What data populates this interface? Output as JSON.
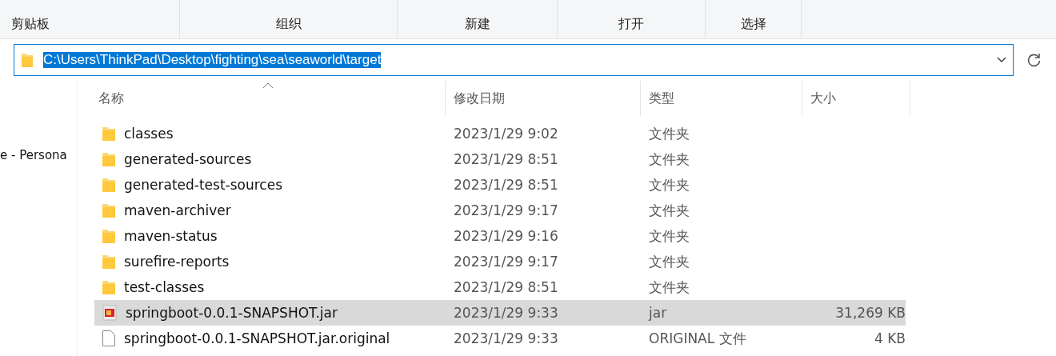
{
  "ribbon": {
    "groups": [
      "剪贴板",
      "组织",
      "新建",
      "打开",
      "选择"
    ]
  },
  "address_bar": {
    "path": "C:\\Users\\ThinkPad\\Desktop\\fighting\\sea\\seaworld\\target",
    "selected": true
  },
  "navigation": {
    "items": [
      "e - Persona"
    ]
  },
  "columns": [
    {
      "label": "名称",
      "sorted": true
    },
    {
      "label": "修改日期",
      "sorted": false
    },
    {
      "label": "类型",
      "sorted": false
    },
    {
      "label": "大小",
      "sorted": false
    }
  ],
  "rows": [
    {
      "kind": "folder",
      "name": "classes",
      "date": "2023/1/29 9:02",
      "type": "文件夹",
      "selected": false
    },
    {
      "kind": "folder",
      "name": "generated-sources",
      "date": "2023/1/29 8:51",
      "type": "文件夹",
      "selected": false
    },
    {
      "kind": "folder",
      "name": "generated-test-sources",
      "date": "2023/1/29 8:51",
      "type": "文件夹",
      "selected": false
    },
    {
      "kind": "folder",
      "name": "maven-archiver",
      "date": "2023/1/29 9:17",
      "type": "文件夹",
      "selected": false
    },
    {
      "kind": "folder",
      "name": "maven-status",
      "date": "2023/1/29 9:16",
      "type": "文件夹",
      "selected": false
    },
    {
      "kind": "folder",
      "name": "surefire-reports",
      "date": "2023/1/29 9:17",
      "type": "文件夹",
      "selected": false
    },
    {
      "kind": "folder",
      "name": "test-classes",
      "date": "2023/1/29 8:51",
      "type": "文件夹",
      "selected": false
    },
    {
      "kind": "jar",
      "name": "springboot-0.0.1-SNAPSHOT.jar",
      "date": "2023/1/29 9:33",
      "type": "jar",
      "size": "31,269 KB",
      "selected": true
    },
    {
      "kind": "file",
      "name": "springboot-0.0.1-SNAPSHOT.jar.original",
      "date": "2023/1/29 9:33",
      "type": "ORIGINAL 文件",
      "size": "4 KB",
      "selected": false
    }
  ]
}
